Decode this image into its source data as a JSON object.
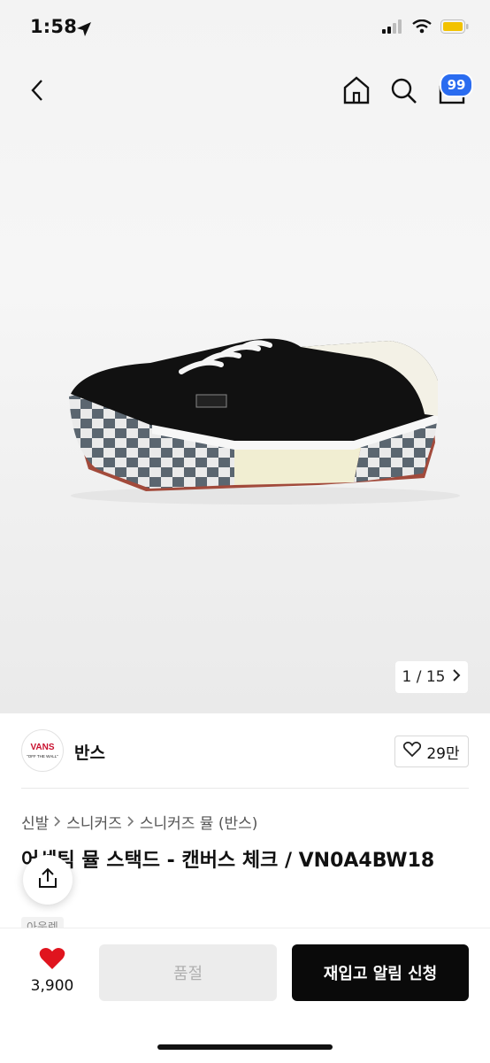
{
  "status_bar": {
    "time": "1:58"
  },
  "nav": {
    "cart_badge": "99"
  },
  "gallery": {
    "counter": "1 / 15"
  },
  "brand": {
    "logo_text": "VANS",
    "logo_sub": "\"OFF THE WALL\"",
    "name": "반스"
  },
  "likes": {
    "count": "29만"
  },
  "breadcrumb": [
    "신발",
    "스니커즈",
    "스니커즈 뮬 (반스)"
  ],
  "product": {
    "title": "어센틱 뮬 스택드 - 캔버스 체크 / VN0A4BW18",
    "tag": "아웃렛"
  },
  "bottom": {
    "wish_count": "3,900",
    "soldout_label": "품절",
    "restock_label": "재입고 알림 신청"
  },
  "colors": {
    "accent_blue": "#2a6cf0",
    "heart_red": "#e0141e",
    "primary_black": "#0a0a0a"
  }
}
